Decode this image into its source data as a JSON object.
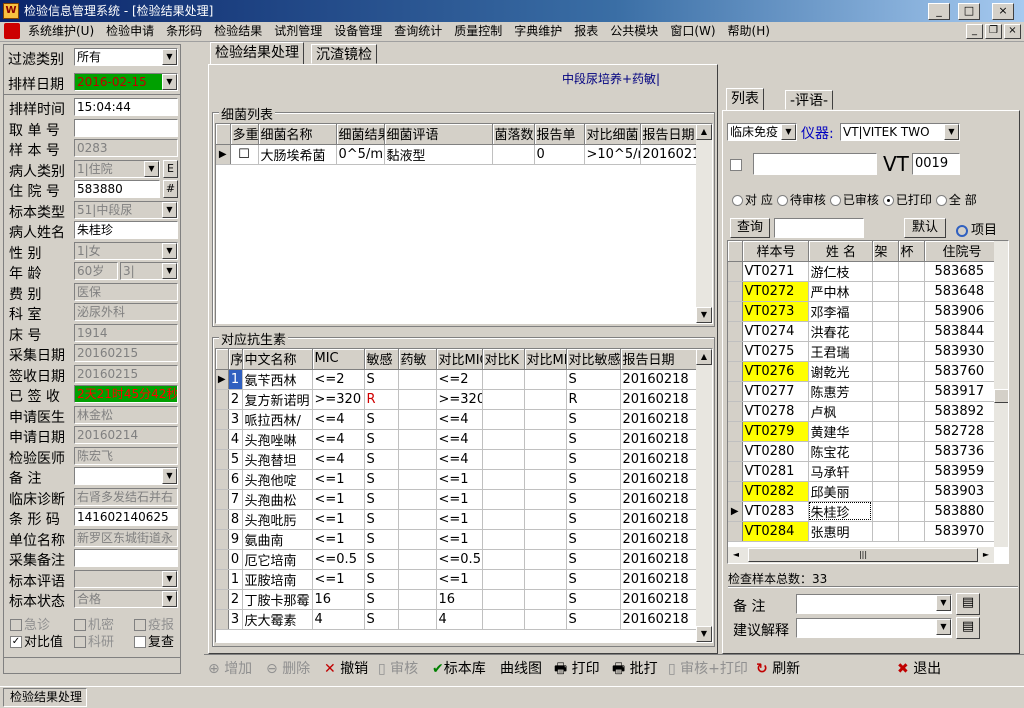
{
  "window": {
    "title": "检验信息管理系统 - [检验结果处理]",
    "min": "_",
    "max": "□",
    "close": "×",
    "mdi_min": "_",
    "mdi_restore": "❐",
    "mdi_close": "×"
  },
  "menu": [
    "系统维护(U)",
    "检验申请",
    "条形码",
    "检验结果",
    "试剂管理",
    "设备管理",
    "查询统计",
    "质量控制",
    "字典维护",
    "报表",
    "公共模块",
    "窗口(W)",
    "帮助(H)"
  ],
  "left": {
    "filter_label": "过滤类别",
    "filter_value": "所有",
    "date_label": "排样日期",
    "date_value": "2016-02-15",
    "fields": [
      {
        "label": "排样时间",
        "value": "15:04:44"
      },
      {
        "label": "取 单 号",
        "value": ""
      },
      {
        "label": "样 本 号",
        "value": "0283"
      },
      {
        "label": "病人类别",
        "value": "1|住院",
        "btn": "E"
      },
      {
        "label": "住 院 号",
        "value": "583880",
        "btn": "#"
      },
      {
        "label": "标本类型",
        "value": "51|中段尿"
      },
      {
        "label": "病人姓名",
        "value": "朱桂珍"
      },
      {
        "label": "性    别",
        "value": "1|女"
      },
      {
        "label": "年    龄",
        "value": "60岁",
        "value2": "3|"
      },
      {
        "label": "费    别",
        "value": "医保"
      },
      {
        "label": "科    室",
        "value": "泌尿外科"
      },
      {
        "label": "床    号",
        "value": "1914"
      },
      {
        "label": "采集日期",
        "value": "20160215"
      },
      {
        "label": "签收日期",
        "value": "20160215"
      },
      {
        "label": "已 签 收",
        "value": "2天21时45分42秒"
      },
      {
        "label": "申请医生",
        "value": "林金松"
      },
      {
        "label": "申请日期",
        "value": "20160214"
      },
      {
        "label": "检验医师",
        "value": "陈宏飞"
      },
      {
        "label": "备    注",
        "value": ""
      },
      {
        "label": "临床诊断",
        "value": "右肾多发结石并右"
      },
      {
        "label": "条 形 码",
        "value": "141602140625"
      },
      {
        "label": "单位名称",
        "value": "新罗区东城街道永"
      },
      {
        "label": "采集备注",
        "value": ""
      },
      {
        "label": "标本评语",
        "value": ""
      },
      {
        "label": "标本状态",
        "value": "合格"
      }
    ],
    "checks": [
      {
        "label": "急诊",
        "checked": false,
        "dis": true
      },
      {
        "label": "机密",
        "checked": false,
        "dis": true
      },
      {
        "label": "疫报",
        "checked": false,
        "dis": true
      },
      {
        "label": "对比值",
        "checked": true,
        "dis": false
      },
      {
        "label": "科研",
        "checked": false,
        "dis": true
      },
      {
        "label": "复查",
        "checked": false,
        "dis": false
      }
    ]
  },
  "center": {
    "tabs": [
      "检验结果处理",
      "沉渣镜检"
    ],
    "subtitle": "中段尿培养+药敏|",
    "bact_title": "细菌列表",
    "bact_headers": [
      "多重",
      "细菌名称",
      "细菌结果",
      "细菌评语",
      "菌落数",
      "报告单",
      "对比细菌",
      "报告日期"
    ],
    "bact_rows": [
      [
        "☐",
        "大肠埃希菌",
        "0^5/ml",
        "黏液型",
        "",
        "0",
        ">10^5/ml",
        "2016021"
      ]
    ],
    "anti_title": "对应抗生素",
    "anti_headers": [
      "序",
      "中文名称",
      "MIC",
      "敏感",
      "药敏",
      "对比MIC",
      "对比K",
      "对比MIC",
      "对比敏感",
      "报告日期"
    ],
    "anti_rows": [
      [
        "1",
        "氨苄西林",
        "<=2",
        "S",
        "",
        "<=2",
        "",
        "",
        "S",
        "20160218"
      ],
      [
        "2",
        "复方新诺明",
        ">=320",
        "R",
        "",
        ">=320",
        "",
        "",
        "R",
        "20160218"
      ],
      [
        "3",
        "哌拉西林/",
        "<=4",
        "S",
        "",
        "<=4",
        "",
        "",
        "S",
        "20160218"
      ],
      [
        "4",
        "头孢唑啉",
        "<=4",
        "S",
        "",
        "<=4",
        "",
        "",
        "S",
        "20160218"
      ],
      [
        "5",
        "头孢替坦",
        "<=4",
        "S",
        "",
        "<=4",
        "",
        "",
        "S",
        "20160218"
      ],
      [
        "6",
        "头孢他啶",
        "<=1",
        "S",
        "",
        "<=1",
        "",
        "",
        "S",
        "20160218"
      ],
      [
        "7",
        "头孢曲松",
        "<=1",
        "S",
        "",
        "<=1",
        "",
        "",
        "S",
        "20160218"
      ],
      [
        "8",
        "头孢吡肟",
        "<=1",
        "S",
        "",
        "<=1",
        "",
        "",
        "S",
        "20160218"
      ],
      [
        "9",
        "氨曲南",
        "<=1",
        "S",
        "",
        "<=1",
        "",
        "",
        "S",
        "20160218"
      ],
      [
        "0",
        "厄它培南",
        "<=0.5",
        "S",
        "",
        "<=0.5",
        "",
        "",
        "S",
        "20160218"
      ],
      [
        "1",
        "亚胺培南",
        "<=1",
        "S",
        "",
        "<=1",
        "",
        "",
        "S",
        "20160218"
      ],
      [
        "2",
        "丁胺卡那霉",
        "16",
        "S",
        "",
        "16",
        "",
        "",
        "S",
        "20160218"
      ],
      [
        "3",
        "庆大霉素",
        "4",
        "S",
        "",
        "4",
        "",
        "",
        "S",
        "20160218"
      ]
    ]
  },
  "right": {
    "tabs": [
      "列表",
      "-评语-"
    ],
    "sel1": "临床免疫",
    "instr_label": "仪器:",
    "instr_value": "VT|VITEK TWO",
    "vt_label": "VT",
    "vt_value": "0019",
    "radios": [
      "对 应",
      "待审核",
      "已审核",
      "已打印",
      "全 部"
    ],
    "query": "查询",
    "default": "默认",
    "items": "项目",
    "headers": [
      "样本号",
      "姓 名",
      "架",
      "杯",
      "住院号"
    ],
    "rows": [
      [
        "VT0271",
        "游仁枝",
        "583685",
        false
      ],
      [
        "VT0272",
        "严中林",
        "583648",
        true
      ],
      [
        "VT0273",
        "邓李福",
        "583906",
        true
      ],
      [
        "VT0274",
        "洪春花",
        "583844",
        false
      ],
      [
        "VT0275",
        "王君瑞",
        "583930",
        false
      ],
      [
        "VT0276",
        "谢乾光",
        "583760",
        true
      ],
      [
        "VT0277",
        "陈惠芳",
        "583917",
        false
      ],
      [
        "VT0278",
        "卢枫",
        "583892",
        false
      ],
      [
        "VT0279",
        "黄建华",
        "582728",
        true
      ],
      [
        "VT0280",
        "陈宝花",
        "583736",
        false
      ],
      [
        "VT0281",
        "马承轩",
        "583959",
        false
      ],
      [
        "VT0282",
        "邱美丽",
        "583903",
        true
      ],
      [
        "VT0283",
        "朱桂珍",
        "583880",
        false
      ],
      [
        "VT0284",
        "张惠明",
        "583970",
        true
      ]
    ],
    "total": "检查样本总数：33",
    "note_label": "备   注",
    "advice_label": "建议解释"
  },
  "toolbar": [
    "增加",
    "删除",
    "撤销",
    "审核",
    "标本库",
    "曲线图",
    "打印",
    "批打",
    "审核+打印",
    "刷新",
    "退出"
  ],
  "status": "检验结果处理"
}
